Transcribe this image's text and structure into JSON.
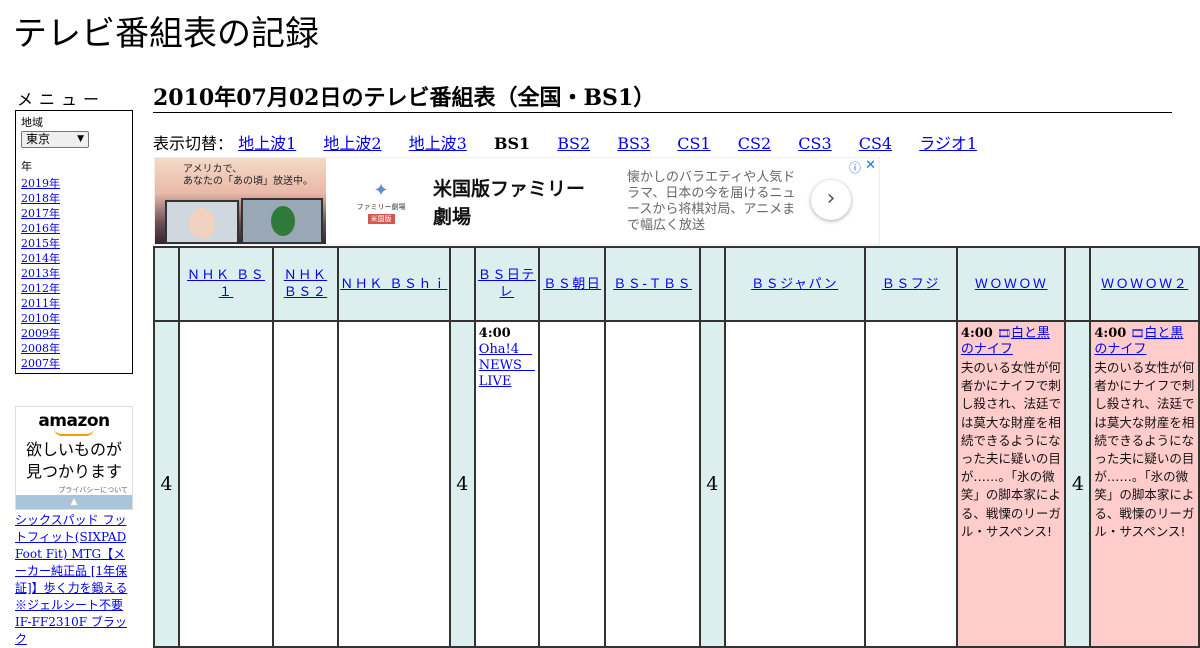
{
  "site": {
    "title": "テレビ番組表の記録"
  },
  "menu": {
    "title": "メニュー",
    "region_label": "地域",
    "region_selected": "東京",
    "year_label": "年",
    "years": [
      "2019年",
      "2018年",
      "2017年",
      "2016年",
      "2015年",
      "2014年",
      "2013年",
      "2012年",
      "2011年",
      "2010年",
      "2009年",
      "2008年",
      "2007年"
    ]
  },
  "amazon_ad": {
    "logo": "amazon",
    "copy_line1": "欲しいものが",
    "copy_line2": "見つかります",
    "privacy": "プライバシーについて",
    "product_text": "シックスパッド フットフィット(SIXPAD Foot Fit) MTG【メーカー純正品 [1年保証]】歩く力を鍛える ※ジェルシート不要 IF-FF2310F ブラック"
  },
  "heading": "2010年07月02日のテレビ番組表（全国・BS1）",
  "switcher": {
    "label": "表示切替：",
    "items": [
      {
        "label": "地上波1",
        "current": false
      },
      {
        "label": "地上波2",
        "current": false
      },
      {
        "label": "地上波3",
        "current": false
      },
      {
        "label": "BS1",
        "current": true
      },
      {
        "label": "BS2",
        "current": false
      },
      {
        "label": "BS3",
        "current": false
      },
      {
        "label": "CS1",
        "current": false
      },
      {
        "label": "CS2",
        "current": false
      },
      {
        "label": "CS3",
        "current": false
      },
      {
        "label": "CS4",
        "current": false
      },
      {
        "label": "ラジオ1",
        "current": false
      }
    ]
  },
  "banner_ad": {
    "image_caption_line1": "アメリカで、",
    "image_caption_line2": "あなたの「あの頃」放送中。",
    "logo_text": "ファミリー劇場",
    "logo_tag": "米国版",
    "headline_line1": "米国版ファミリー",
    "headline_line2": "劇場",
    "description": "懐かしのバラエティや人気ドラマ、日本の今を届けるニュースから将棋対局、アニメまで幅広く放送",
    "next_icon": "chevron-right-icon",
    "adchoices_icon": "info-icon",
    "close_icon": "close-icon"
  },
  "schedule": {
    "hour": "4",
    "channels": [
      "ＮＨＫ ＢＳ１",
      "ＮＨＫ ＢＳ２",
      "ＮＨＫ ＢＳｈｉ",
      "ＢＳ日テレ",
      "ＢＳ朝日",
      "ＢＳ-ＴＢＳ",
      "ＢＳジャパン",
      "ＢＳフジ",
      "ＷＯＷＯＷ",
      "ＷＯＷＯＷ２"
    ],
    "programs": {
      "bs_nittele": {
        "time": "4:00",
        "title": "Oha!4　NEWS　LIVE"
      },
      "wowow": {
        "time": "4:00",
        "title": "白と黒のナイフ",
        "description": "夫のいる女性が何者かにナイフで刺し殺され、法廷では莫大な財産を相続できるようになった夫に疑いの目が……。「氷の微笑」の脚本家による、戦慄のリーガル・サスペンス!"
      },
      "wowow2": {
        "time": "4:00",
        "title": "白と黒のナイフ",
        "description": "夫のいる女性が何者かにナイフで刺し殺され、法廷では莫大な財産を相続できるようになった夫に疑いの目が……。「氷の微笑」の脚本家による、戦慄のリーガル・サスペンス!"
      }
    }
  },
  "colors": {
    "header_bg": "#dcefee",
    "highlight_bg": "#ffcccc",
    "link": "#0000ee"
  }
}
